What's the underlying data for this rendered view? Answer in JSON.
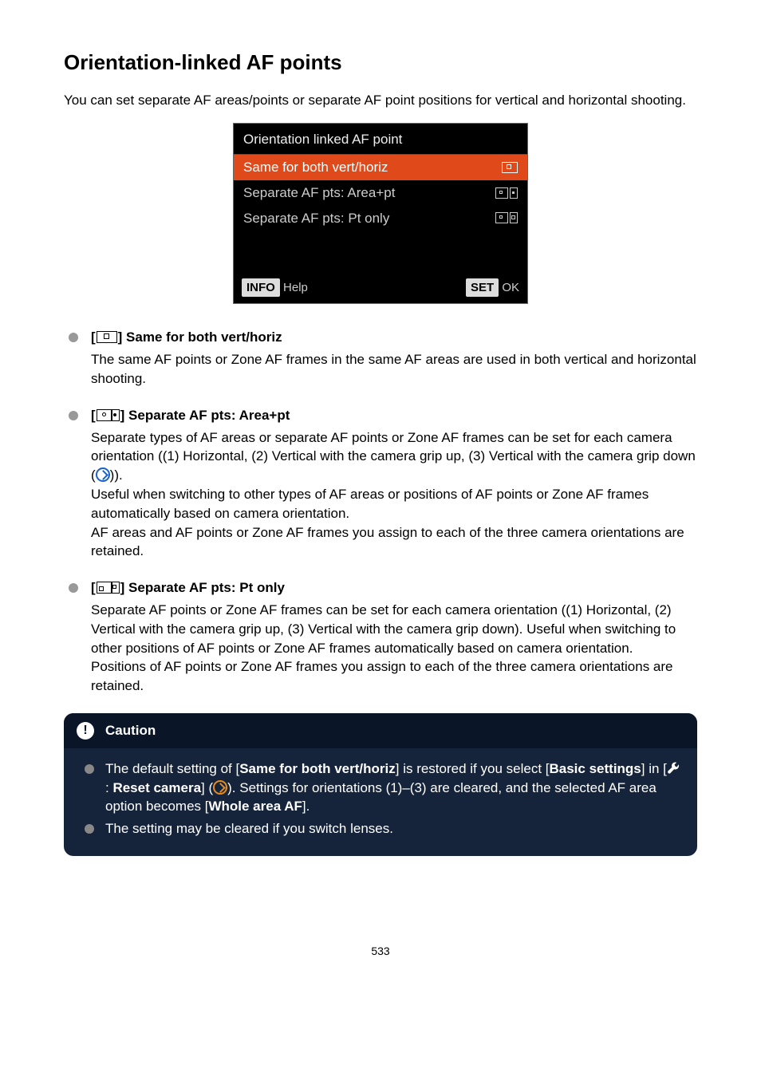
{
  "heading": "Orientation-linked AF points",
  "intro": "You can set separate AF areas/points or separate AF point positions for vertical and horizontal shooting.",
  "camScreen": {
    "title": "Orientation linked AF point",
    "rows": [
      {
        "label": "Same for both vert/horiz",
        "selected": true
      },
      {
        "label": "Separate AF pts: Area+pt",
        "selected": false
      },
      {
        "label": "Separate AF pts: Pt only",
        "selected": false
      }
    ],
    "footer": {
      "leftBadge": "INFO",
      "leftLabel": "Help",
      "rightBadge": "SET",
      "rightLabel": "OK"
    }
  },
  "items": [
    {
      "title": "] Same for both vert/horiz",
      "body": "The same AF points or Zone AF frames in the same AF areas are used in both vertical and horizontal shooting."
    },
    {
      "title": "] Separate AF pts: Area+pt",
      "body1": "Separate types of AF areas or separate AF points or Zone AF frames can be set for each camera orientation ((1) Horizontal, (2) Vertical with the camera grip up, (3) Vertical with the camera grip down (",
      "body1b": ")).",
      "body2": "Useful when switching to other types of AF areas or positions of AF points or Zone AF frames automatically based on camera orientation.",
      "body3": "AF areas and AF points or Zone AF frames you assign to each of the three camera orientations are retained."
    },
    {
      "title": "] Separate AF pts: Pt only",
      "body1": "Separate AF points or Zone AF frames can be set for each camera orientation ((1) Horizontal, (2) Vertical with the camera grip up, (3) Vertical with the camera grip down). Useful when switching to other positions of AF points or Zone AF frames automatically based on camera orientation.",
      "body2": "Positions of AF points or Zone AF frames you assign to each of the three camera orientations are retained."
    }
  ],
  "caution": {
    "title": "Caution",
    "item1a": "The default setting of [",
    "item1b": "Same for both vert/horiz",
    "item1c": "] is restored if you select [",
    "item1d": "Basic settings",
    "item1e": "] in [",
    "item1f": ": ",
    "item1g": "Reset camera",
    "item1h": "] (",
    "item1i": "). Settings for orientations (1)–(3) are cleared, and the selected AF area option becomes [",
    "item1j": "Whole area AF",
    "item1k": "].",
    "item2": "The setting may be cleared if you switch lenses."
  },
  "pageNumber": "533",
  "bracketOpen": "["
}
